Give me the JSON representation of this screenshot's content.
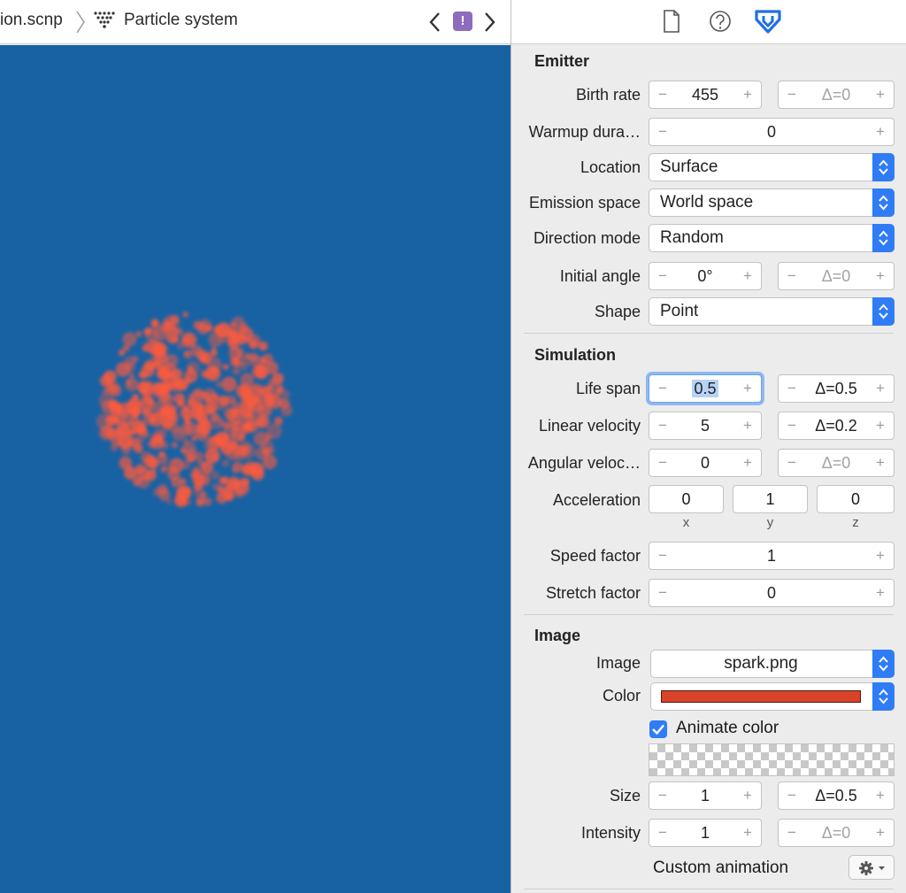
{
  "jumpbar": {
    "file_name": "ion.scnp",
    "node_name": "Particle system",
    "issue_badge": "!"
  },
  "inspector_tabs": [
    "file-inspector-icon",
    "quick-help-icon",
    "attributes-inspector-icon"
  ],
  "emitter": {
    "title": "Emitter",
    "birth_rate": {
      "label": "Birth rate",
      "value": "455",
      "delta": "Δ=0"
    },
    "warmup": {
      "label": "Warmup dura…",
      "value": "0"
    },
    "location": {
      "label": "Location",
      "value": "Surface"
    },
    "emission_space": {
      "label": "Emission space",
      "value": "World space"
    },
    "direction_mode": {
      "label": "Direction mode",
      "value": "Random"
    },
    "initial_angle": {
      "label": "Initial angle",
      "value": "0°",
      "delta": "Δ=0"
    },
    "shape": {
      "label": "Shape",
      "value": "Point"
    }
  },
  "simulation": {
    "title": "Simulation",
    "life_span": {
      "label": "Life span",
      "value": "0.5",
      "delta": "Δ=0.5"
    },
    "linear_velocity": {
      "label": "Linear velocity",
      "value": "5",
      "delta": "Δ=0.2"
    },
    "angular_velocity": {
      "label": "Angular veloc…",
      "value": "0",
      "delta": "Δ=0"
    },
    "acceleration": {
      "label": "Acceleration",
      "x": "0",
      "y": "1",
      "z": "0",
      "x_label": "x",
      "y_label": "y",
      "z_label": "z"
    },
    "speed_factor": {
      "label": "Speed factor",
      "value": "1"
    },
    "stretch_factor": {
      "label": "Stretch factor",
      "value": "0"
    }
  },
  "image": {
    "title": "Image",
    "image": {
      "label": "Image",
      "value": "spark.png"
    },
    "color": {
      "label": "Color",
      "swatch": "#d9432a"
    },
    "animate_color": {
      "label": "Animate color",
      "checked": true
    },
    "size": {
      "label": "Size",
      "value": "1",
      "delta": "Δ=0.5"
    },
    "intensity": {
      "label": "Intensity",
      "value": "1",
      "delta": "Δ=0"
    },
    "custom_animation": {
      "label": "Custom animation"
    }
  },
  "colors": {
    "viewport_bg": "#1862a4",
    "particle": "#ff5a3c",
    "accent": "#2f7cf6"
  }
}
